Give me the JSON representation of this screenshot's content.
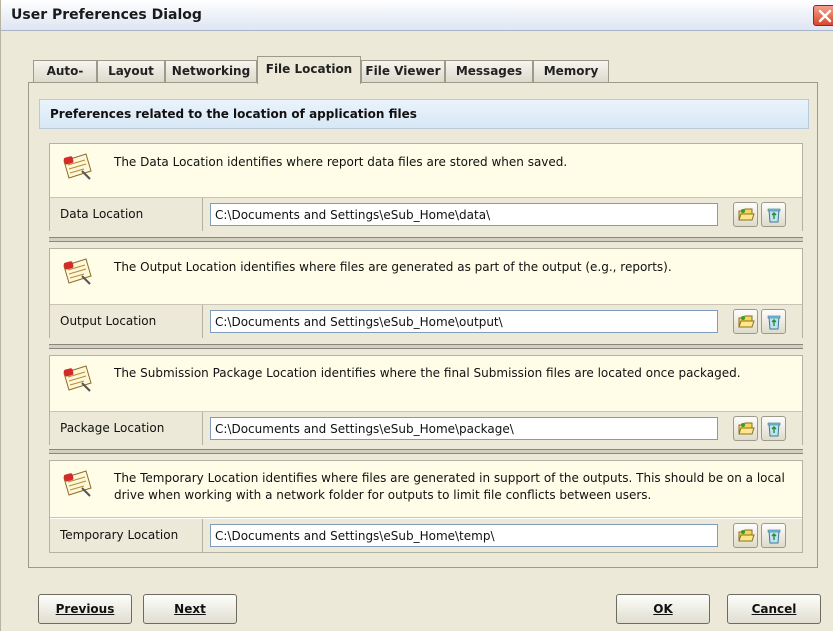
{
  "window": {
    "title": "User Preferences Dialog"
  },
  "tabs": [
    {
      "label": "Auto-Save",
      "active": false
    },
    {
      "label": "Layout",
      "active": false
    },
    {
      "label": "Networking",
      "active": false
    },
    {
      "label": "File Location",
      "active": true
    },
    {
      "label": "File Viewer",
      "active": false
    },
    {
      "label": "Messages",
      "active": false
    },
    {
      "label": "Memory",
      "active": false
    }
  ],
  "panel": {
    "header": "Preferences related to the location of application files",
    "sections": [
      {
        "info": "The Data Location identifies where report data files are stored when saved.",
        "label": "Data Location",
        "value": "C:\\Documents and Settings\\eSub_Home\\data\\"
      },
      {
        "info": "The Output Location identifies where files are generated as part of the output (e.g., reports).",
        "label": "Output Location",
        "value": "C:\\Documents and Settings\\eSub_Home\\output\\"
      },
      {
        "info": "The Submission Package Location identifies where the final Submission files are located once packaged.",
        "label": "Package Location",
        "value": "C:\\Documents and Settings\\eSub_Home\\package\\"
      },
      {
        "info": "The Temporary Location identifies where files are generated in support of the outputs. This should be on a local drive when working with a network folder for outputs to limit file conflicts between users.",
        "label": "Temporary Location",
        "value": "C:\\Documents and Settings\\eSub_Home\\temp\\"
      }
    ]
  },
  "buttons": {
    "previous": "Previous",
    "next": "Next",
    "ok": "OK",
    "cancel": "Cancel"
  },
  "icons": {
    "info": "note-pad-icon",
    "browse": "open-folder-icon",
    "clear": "recycle-bin-icon",
    "close": "close-icon"
  }
}
